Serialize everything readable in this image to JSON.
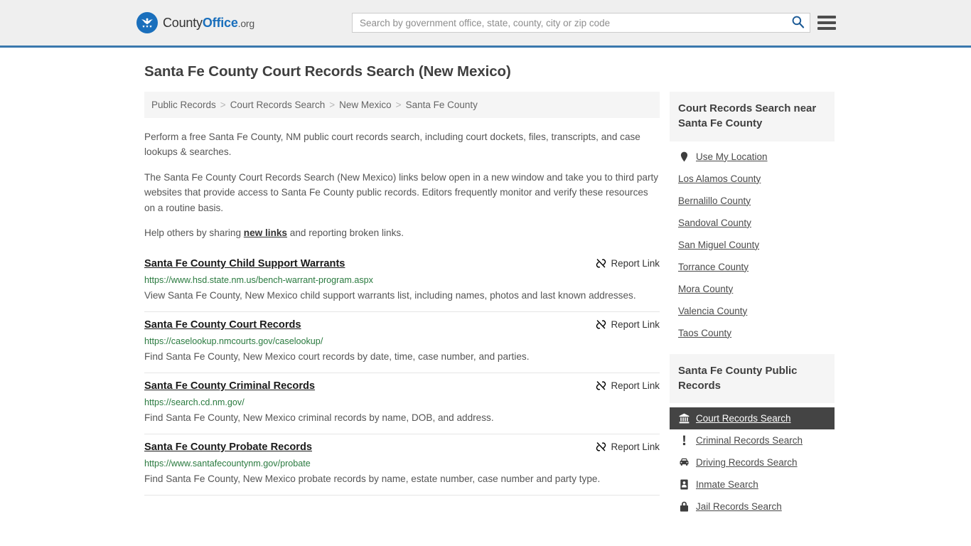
{
  "header": {
    "brand": {
      "part1": "County",
      "part2": "Office",
      "part3": ".org"
    },
    "search": {
      "placeholder": "Search by government office, state, county, city or zip code",
      "value": ""
    },
    "accent_color": "#3a78ad",
    "background_color": "#efefef"
  },
  "main": {
    "title": "Santa Fe County Court Records Search (New Mexico)",
    "breadcrumb": [
      "Public Records",
      "Court Records Search",
      "New Mexico",
      "Santa Fe County"
    ],
    "breadcrumb_separator": ">",
    "intro": {
      "paragraph1": "Perform a free Santa Fe County, NM public court records search, including court dockets, files, transcripts, and case lookups & searches.",
      "paragraph2": "The Santa Fe County Court Records Search (New Mexico) links below open in a new window and take you to third party websites that provide access to Santa Fe County public records. Editors frequently monitor and verify these resources on a routine basis.",
      "paragraph3_before": "Help others by sharing ",
      "paragraph3_link": "new links",
      "paragraph3_after": " and reporting broken links."
    },
    "report_link_label": "Report Link",
    "results": [
      {
        "title": "Santa Fe County Child Support Warrants",
        "url": "https://www.hsd.state.nm.us/bench-warrant-program.aspx",
        "description": "View Santa Fe County, New Mexico child support warrants list, including names, photos and last known addresses."
      },
      {
        "title": "Santa Fe County Court Records",
        "url": "https://caselookup.nmcourts.gov/caselookup/",
        "description": "Find Santa Fe County, New Mexico court records by date, time, case number, and parties."
      },
      {
        "title": "Santa Fe County Criminal Records",
        "url": "https://search.cd.nm.gov/",
        "description": "Find Santa Fe County, New Mexico criminal records by name, DOB, and address."
      },
      {
        "title": "Santa Fe County Probate Records",
        "url": "https://www.santafecountynm.gov/probate",
        "description": "Find Santa Fe County, New Mexico probate records by name, estate number, case number and party type."
      }
    ]
  },
  "sidebar": {
    "nearby": {
      "heading": "Court Records Search near Santa Fe County",
      "items": [
        {
          "label": "Use My Location",
          "icon": "map-pin-icon"
        },
        {
          "label": "Los Alamos County",
          "icon": ""
        },
        {
          "label": "Bernalillo County",
          "icon": ""
        },
        {
          "label": "Sandoval County",
          "icon": ""
        },
        {
          "label": "San Miguel County",
          "icon": ""
        },
        {
          "label": "Torrance County",
          "icon": ""
        },
        {
          "label": "Mora County",
          "icon": ""
        },
        {
          "label": "Valencia County",
          "icon": ""
        },
        {
          "label": "Taos County",
          "icon": ""
        }
      ]
    },
    "public_records": {
      "heading": "Santa Fe County Public Records",
      "active_index": 0,
      "items": [
        {
          "label": "Court Records Search",
          "icon": "courthouse-icon",
          "active": true
        },
        {
          "label": "Criminal Records Search",
          "icon": "exclamation-icon",
          "active": false
        },
        {
          "label": "Driving Records Search",
          "icon": "car-icon",
          "active": false
        },
        {
          "label": "Inmate Search",
          "icon": "id-card-icon",
          "active": false
        },
        {
          "label": "Jail Records Search",
          "icon": "lock-icon",
          "active": false
        }
      ],
      "active_background_color": "#444444"
    }
  }
}
